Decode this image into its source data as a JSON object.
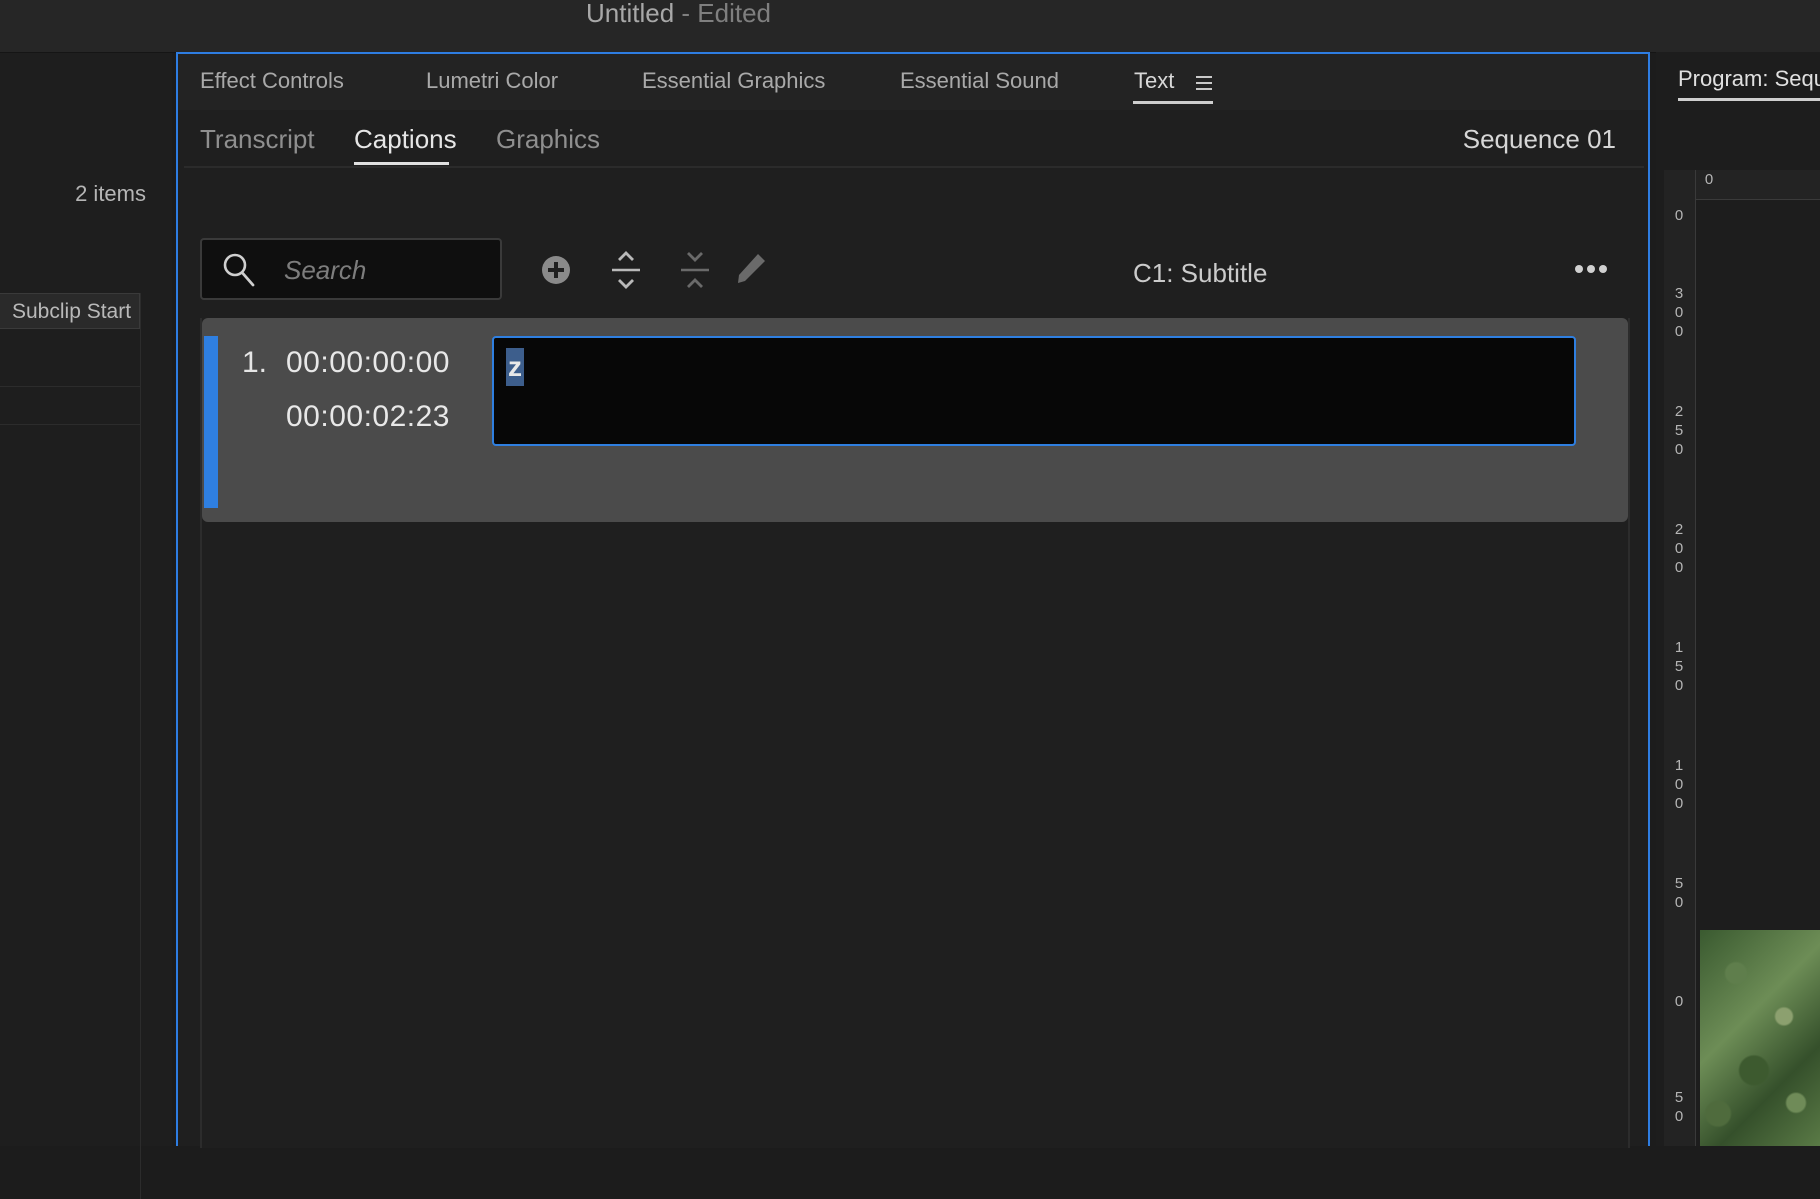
{
  "window": {
    "title": "Untitled",
    "title_suffix": "- Edited"
  },
  "left_panel": {
    "items_count": "2 items",
    "column_header": "Subclip Start"
  },
  "panel_tabs": [
    {
      "label": "Effect Controls"
    },
    {
      "label": "Lumetri Color"
    },
    {
      "label": "Essential Graphics"
    },
    {
      "label": "Essential Sound"
    },
    {
      "label": "Text",
      "active": true
    }
  ],
  "sub_tabs": [
    {
      "label": "Transcript"
    },
    {
      "label": "Captions",
      "active": true
    },
    {
      "label": "Graphics"
    }
  ],
  "sequence_name": "Sequence 01",
  "toolbar": {
    "search_placeholder": "Search",
    "track_label": "C1: Subtitle",
    "icons": [
      "add-caption-icon",
      "expand-collapse-icon",
      "merge-icon",
      "pencil-icon",
      "more-icon"
    ]
  },
  "captions": [
    {
      "number": "1.",
      "start": "00:00:00:00",
      "end": "00:00:02:23",
      "text": "z"
    }
  ],
  "program_monitor": {
    "tab_label": "Program: Sequ",
    "horizontal_ruler": [
      "0"
    ],
    "vertical_ruler": [
      "0",
      "300",
      "250",
      "200",
      "150",
      "100",
      "50",
      "0",
      "50"
    ]
  },
  "colors": {
    "accent": "#2f7fe0",
    "background": "#1f1f1f"
  }
}
